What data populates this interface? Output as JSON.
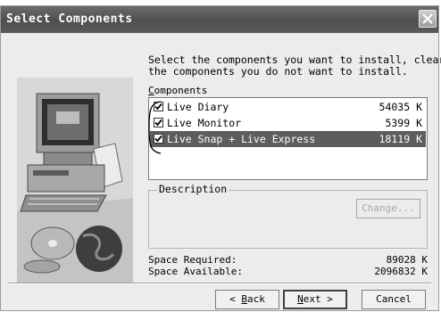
{
  "window": {
    "title": "Select Components"
  },
  "instructions": "Select the components you want to install, clear\nthe components you do not want to install.",
  "components": {
    "label_underlined": "C",
    "label_rest": "omponents",
    "items": [
      {
        "name": "Live Diary",
        "size": "54035 K",
        "checked": true,
        "selected": false
      },
      {
        "name": "Live Monitor",
        "size": "5399 K",
        "checked": true,
        "selected": false
      },
      {
        "name": "Live Snap + Live Express",
        "size": "18119 K",
        "checked": true,
        "selected": true
      }
    ]
  },
  "description": {
    "label": "Description",
    "change_button": "Change..."
  },
  "space": {
    "required_label": "Space Required:",
    "required_value": "89028 K",
    "available_label": "Space Available:",
    "available_value": "2096832 K"
  },
  "buttons": {
    "back_prefix": "< ",
    "back_underlined": "B",
    "back_rest": "ack",
    "next_underlined": "N",
    "next_rest": "ext >",
    "cancel": "Cancel"
  },
  "colors": {
    "titlebar": "#555555",
    "selection": "#5d5d5d"
  }
}
